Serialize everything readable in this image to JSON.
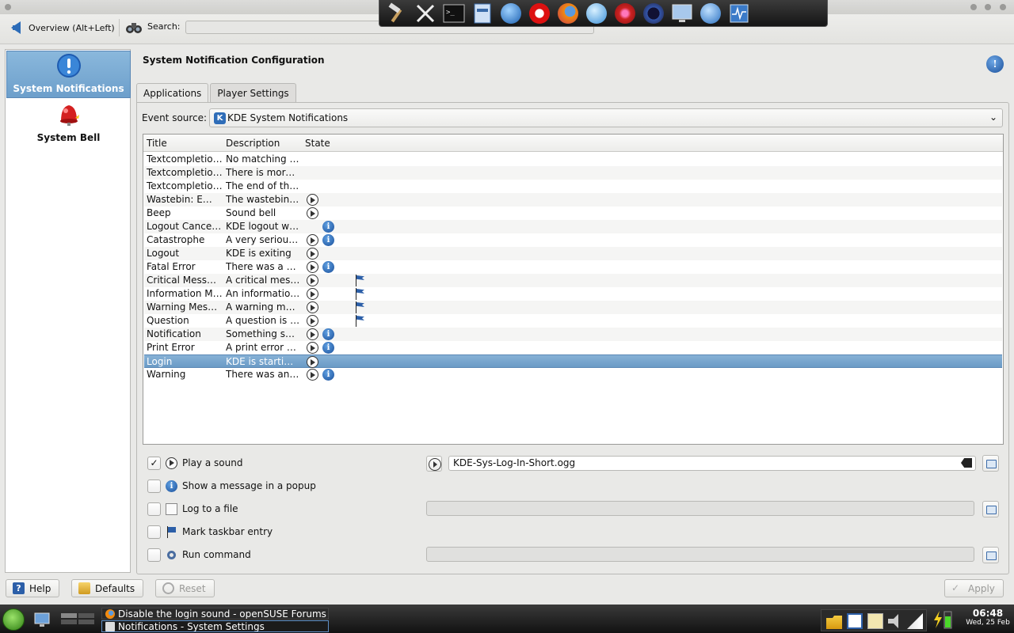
{
  "toolbar": {
    "back_label": "Overview (Alt+Left)",
    "search_label": "Search:",
    "search_value": ""
  },
  "dock": {
    "icons": [
      "hammer-icon",
      "tools-icon",
      "terminal-icon",
      "file-manager-icon",
      "globe-icon",
      "opera-icon",
      "firefox-icon",
      "chat-icon",
      "bug-icon",
      "glasses-icon",
      "display-icon",
      "dolphin-icon",
      "system-monitor-icon"
    ]
  },
  "sidebar": {
    "items": [
      {
        "label": "System Notifications",
        "icon": "exclamation-icon",
        "selected": true
      },
      {
        "label": "System Bell",
        "icon": "bell-icon",
        "selected": false
      }
    ]
  },
  "main": {
    "title": "System Notification Configuration",
    "tabs": [
      {
        "label": "Applications",
        "active": true
      },
      {
        "label": "Player Settings",
        "active": false
      }
    ],
    "event_source_label": "Event source:",
    "event_source_value": "KDE System Notifications"
  },
  "table": {
    "columns": [
      "Title",
      "Description",
      "State"
    ],
    "rows": [
      {
        "title": "Textcompletio…",
        "desc": "No matching …",
        "play": false,
        "info": false,
        "flag": false
      },
      {
        "title": "Textcompletio…",
        "desc": "There is more…",
        "play": false,
        "info": false,
        "flag": false
      },
      {
        "title": "Textcompletio…",
        "desc": "The end of th…",
        "play": false,
        "info": false,
        "flag": false
      },
      {
        "title": "Wastebin: E…",
        "desc": "The wastebin …",
        "play": true,
        "info": false,
        "flag": false
      },
      {
        "title": "Beep",
        "desc": "Sound bell",
        "play": true,
        "info": false,
        "flag": false
      },
      {
        "title": "Logout Cance…",
        "desc": "KDE logout w…",
        "play": false,
        "info": true,
        "flag": false
      },
      {
        "title": "Catastrophe",
        "desc": "A very seriou…",
        "play": true,
        "info": true,
        "flag": false
      },
      {
        "title": "Logout",
        "desc": "KDE is exiting",
        "play": true,
        "info": false,
        "flag": false
      },
      {
        "title": "Fatal Error",
        "desc": "There was a …",
        "play": true,
        "info": true,
        "flag": false
      },
      {
        "title": "Critical Mess…",
        "desc": "A critical mes…",
        "play": true,
        "info": false,
        "flag": true
      },
      {
        "title": "Information M…",
        "desc": "An informatio…",
        "play": true,
        "info": false,
        "flag": true
      },
      {
        "title": "Warning Mes…",
        "desc": "A warning me…",
        "play": true,
        "info": false,
        "flag": true
      },
      {
        "title": "Question",
        "desc": "A question is …",
        "play": true,
        "info": false,
        "flag": true
      },
      {
        "title": "Notification",
        "desc": "Something sp…",
        "play": true,
        "info": true,
        "flag": false
      },
      {
        "title": "Print Error",
        "desc": "A print error h…",
        "play": true,
        "info": true,
        "flag": false
      },
      {
        "title": "Login",
        "desc": "KDE is starti…",
        "play": true,
        "info": false,
        "flag": false,
        "selected": true
      },
      {
        "title": "Warning",
        "desc": "There was an…",
        "play": true,
        "info": true,
        "flag": false
      }
    ]
  },
  "actions": {
    "play_sound": {
      "label": "Play a sound",
      "checked": true,
      "file": "KDE-Sys-Log-In-Short.ogg"
    },
    "popup": {
      "label": "Show a message in a popup",
      "checked": false
    },
    "log_file": {
      "label": "Log to a file",
      "checked": false,
      "value": ""
    },
    "taskbar": {
      "label": "Mark taskbar entry",
      "checked": false
    },
    "run_command": {
      "label": "Run command",
      "checked": false,
      "value": ""
    }
  },
  "buttons": {
    "help": "Help",
    "defaults": "Defaults",
    "reset": "Reset",
    "apply": "Apply"
  },
  "taskbar": {
    "tasks": [
      {
        "label": "Disable the login sound - openSUSE Forums",
        "icon": "firefox-icon"
      },
      {
        "label": "Notifications - System Settings",
        "icon": "settings-icon",
        "active": true
      }
    ],
    "clock_time": "06:48",
    "clock_date": "Wed, 25 Feb"
  },
  "colors": {
    "selection": "#6d9fcb",
    "accent": "#2c6cb8"
  }
}
